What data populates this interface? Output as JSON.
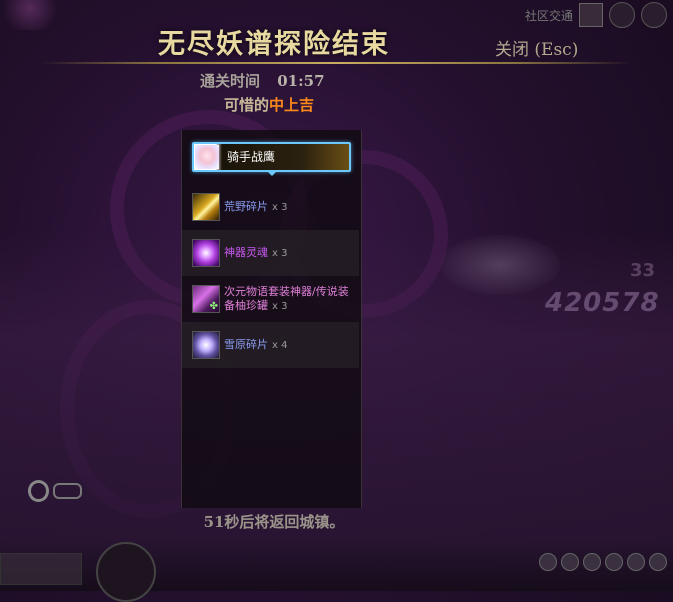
{
  "dialog": {
    "title": "无尽妖谱探险结束",
    "close_label": "关闭 (Esc)",
    "clear_time_label": "通关时间",
    "clear_time_value": "01:57",
    "rank_prefix": "可惜的",
    "rank_grade": "中上吉",
    "return_message": "51秒后将返回城镇。"
  },
  "character": {
    "name": "骑手战鹰"
  },
  "rewards": [
    {
      "name": "荒野碎片",
      "qty": "x 3",
      "icon": "gold-shard-icon",
      "color": "#8a9cf0"
    },
    {
      "name": "神器灵魂",
      "qty": "x 3",
      "icon": "artifact-soul-icon",
      "color": "#c858f0"
    },
    {
      "name": "次元物语套装神器/传说装备柚珍罐",
      "qty": "x 3",
      "icon": "treasure-jar-icon",
      "color": "#e080d8"
    },
    {
      "name": "雪原碎片",
      "qty": "x 4",
      "icon": "snow-shard-icon",
      "color": "#8a9cf0"
    }
  ],
  "background": {
    "damage_number": "420578",
    "damage_number_partial": "33",
    "top_hud_text": "社区交通"
  }
}
